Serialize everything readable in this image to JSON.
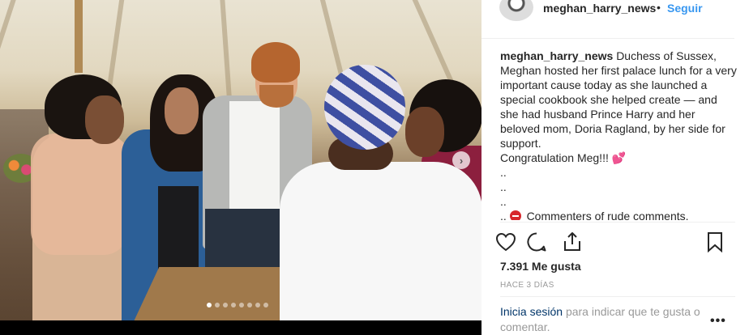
{
  "post": {
    "username": "meghan_harry_news",
    "separator": "•",
    "follow_label": "Seguir",
    "carousel_dot_count": 8,
    "carousel_active_index": 0
  },
  "caption": {
    "username": "meghan_harry_news",
    "text_1": "Duchess of Sussex, Meghan hosted her first palace lunch for a very important cause today as she launched a special cookbook she helped create — and she had husband Prince Harry and her beloved mom, Doria Ragland, by her side for support.",
    "text_2": "Congratulation Meg!!! 💕",
    "dots_1": "..",
    "dots_2": "..",
    "dots_3": "..",
    "prefix_4": "..",
    "text_4": "Commenters of rude comments."
  },
  "actions": {
    "like_icon": "heart-outline",
    "comment_icon": "speech-bubble",
    "share_icon": "upload-arrow",
    "save_icon": "bookmark-outline"
  },
  "stats": {
    "likes": "7.391 Me gusta",
    "time": "HACE 3 DÍAS"
  },
  "login_prompt": {
    "link": "Inicia sesión",
    "text": "para indicar que te gusta o comentar.",
    "more": "•••"
  },
  "colors": {
    "link_blue": "#3897f0",
    "text": "#262626",
    "muted": "#999999"
  }
}
